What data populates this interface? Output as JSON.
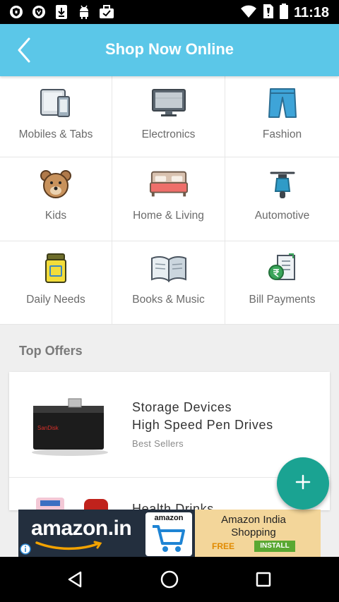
{
  "status_bar": {
    "time": "11:18",
    "icons": [
      "vpn-shield-icon",
      "vpn-shield-icon",
      "download-icon",
      "android-icon",
      "briefcase-check-icon",
      "wifi-icon",
      "sim-no-signal-icon",
      "battery-icon"
    ]
  },
  "app_bar": {
    "title": "Shop Now Online",
    "back_icon": "back-chevron-icon",
    "color": "#5bc7e8"
  },
  "categories": [
    {
      "label": "Mobiles & Tabs",
      "icon": "mobiles-tabs-icon"
    },
    {
      "label": "Electronics",
      "icon": "monitor-icon"
    },
    {
      "label": "Fashion",
      "icon": "jeans-icon"
    },
    {
      "label": "Kids",
      "icon": "teddy-bear-icon"
    },
    {
      "label": "Home & Living",
      "icon": "bed-icon"
    },
    {
      "label": "Automotive",
      "icon": "scooter-icon"
    },
    {
      "label": "Daily Needs",
      "icon": "jar-icon"
    },
    {
      "label": "Books & Music",
      "icon": "open-book-icon"
    },
    {
      "label": "Bill Payments",
      "icon": "rupee-bill-icon"
    }
  ],
  "offers": {
    "title": "Top Offers",
    "items": [
      {
        "line1": "Storage Devices",
        "line2": "High Speed Pen Drives",
        "sub": "Best Sellers",
        "thumb": "pen-drive-image",
        "thumb_label": "SanDisk"
      },
      {
        "line1": "Health Drinks",
        "thumb": "health-drinks-image"
      }
    ]
  },
  "fab": {
    "icon": "plus-icon",
    "color": "#1aa392"
  },
  "ad": {
    "brand": "amazon.in",
    "cart_brand": "amazon",
    "app_title": "Amazon India Shopping",
    "free": "FREE",
    "install": "INSTALL"
  },
  "nav_bar": {
    "icons": [
      "back-triangle-icon",
      "home-circle-icon",
      "recents-square-icon"
    ]
  }
}
